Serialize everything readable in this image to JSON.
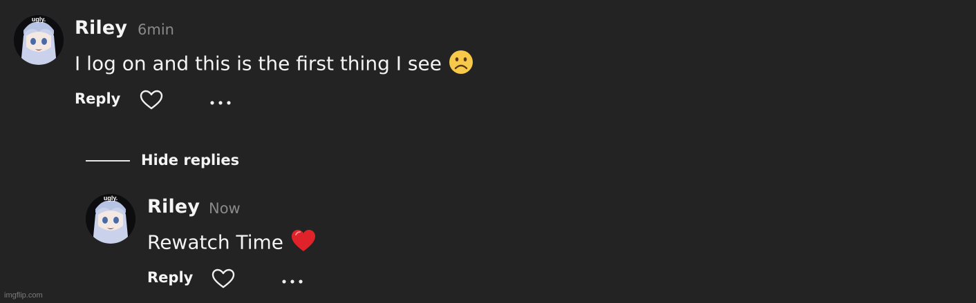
{
  "comments": [
    {
      "username": "Riley",
      "time": "6min",
      "text": "I log on and this is the first thing I see",
      "emoji": "frowning-face-emoji",
      "reply_label": "Reply",
      "avatar_caption": "ugly."
    }
  ],
  "hide_replies_label": "Hide replies",
  "replies": [
    {
      "username": "Riley",
      "time": "Now",
      "text": "Rewatch Time",
      "emoji": "red-heart-emoji",
      "reply_label": "Reply",
      "avatar_caption": "ugly."
    }
  ],
  "watermark": "imgflip.com",
  "colors": {
    "background": "#232323",
    "text": "#f4f4f4",
    "muted": "#8a8a8a"
  }
}
